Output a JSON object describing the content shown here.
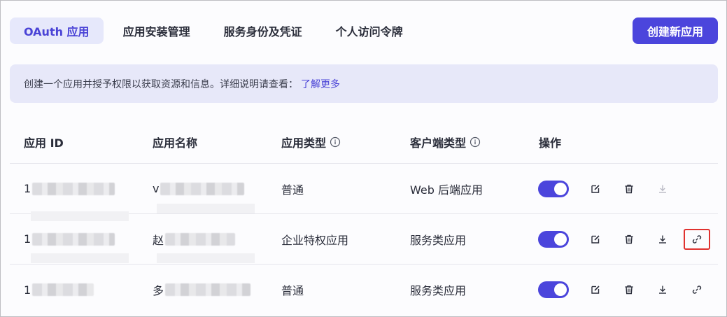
{
  "tabs": [
    {
      "label": "OAuth 应用",
      "active": true
    },
    {
      "label": "应用安装管理",
      "active": false
    },
    {
      "label": "服务身份及凭证",
      "active": false
    },
    {
      "label": "个人访问令牌",
      "active": false
    }
  ],
  "create_button": "创建新应用",
  "notice": {
    "text": "创建一个应用并授予权限以获取资源和信息。详细说明请查看：",
    "link": "了解更多"
  },
  "table": {
    "headers": {
      "id": "应用 ID",
      "name": "应用名称",
      "type": "应用类型",
      "client_type": "客户端类型",
      "ops": "操作"
    },
    "rows": [
      {
        "id_prefix": "1",
        "name_prefix": "v",
        "type": "普通",
        "client_type": "Web 后端应用",
        "enabled": true,
        "download_enabled": false,
        "has_link": false
      },
      {
        "id_prefix": "1",
        "name_prefix": "赵",
        "type": "企业特权应用",
        "client_type": "服务类应用",
        "enabled": true,
        "download_enabled": true,
        "has_link": true,
        "link_highlighted": true
      },
      {
        "id_prefix": "1",
        "name_prefix": "多",
        "type": "普通",
        "client_type": "服务类应用",
        "enabled": true,
        "download_enabled": true,
        "has_link": true,
        "link_highlighted": false
      }
    ]
  },
  "colors": {
    "accent": "#4b45dc",
    "tab_active_bg": "#e6e8fb",
    "notice_bg": "#e7e8f9",
    "highlight": "#e0322f"
  },
  "icons": {
    "info": "info-icon",
    "edit": "edit-icon",
    "delete": "trash-icon",
    "download": "download-icon",
    "link": "link-icon"
  }
}
